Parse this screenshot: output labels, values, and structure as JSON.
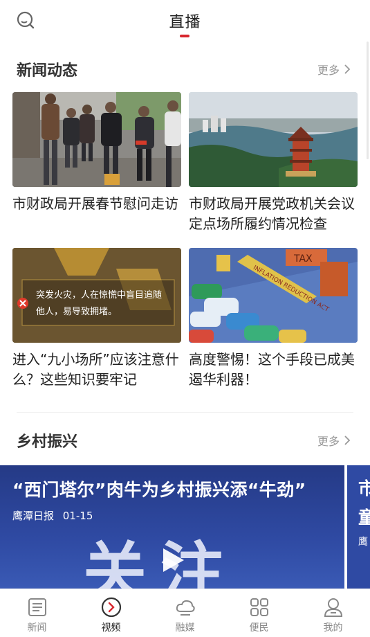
{
  "header": {
    "title": "直播"
  },
  "news_section": {
    "title": "新闻动态",
    "more": "更多",
    "items": [
      {
        "title": "市财政局开展春节慰问走访"
      },
      {
        "title": "市财政局开展党政机关会议定点场所履约情况检查"
      },
      {
        "title": "进入“九小场所”应该注意什么？这些知识要牢记",
        "overlay_line1": "突发火灾，人在惊慌中盲目追随",
        "overlay_line2": "他人，易导致拥堵。"
      },
      {
        "title": "高度警惕！这个手段已成美遏华利器！",
        "overlay_sign1": "TAX",
        "overlay_sign2": "INFLATION REDUCTION ACT"
      }
    ]
  },
  "rural_section": {
    "title": "乡村振兴",
    "more": "更多",
    "video": {
      "title": "“西门塔尔”肉牛为乡村振兴添“牛劲”",
      "source": "鹰潭日报",
      "date": "01-15",
      "bg_text": "关注"
    },
    "video2": {
      "line1": "市",
      "line2": "童",
      "source": "鹰"
    }
  },
  "tabbar": {
    "tabs": [
      {
        "label": "新闻",
        "icon": "news-icon"
      },
      {
        "label": "视频",
        "icon": "video-icon",
        "active": true
      },
      {
        "label": "融媒",
        "icon": "cloud-icon"
      },
      {
        "label": "便民",
        "icon": "grid-icon"
      },
      {
        "label": "我的",
        "icon": "user-icon"
      }
    ]
  },
  "colors": {
    "accent": "#d8262e",
    "video_bg": "#2f4aa3"
  }
}
